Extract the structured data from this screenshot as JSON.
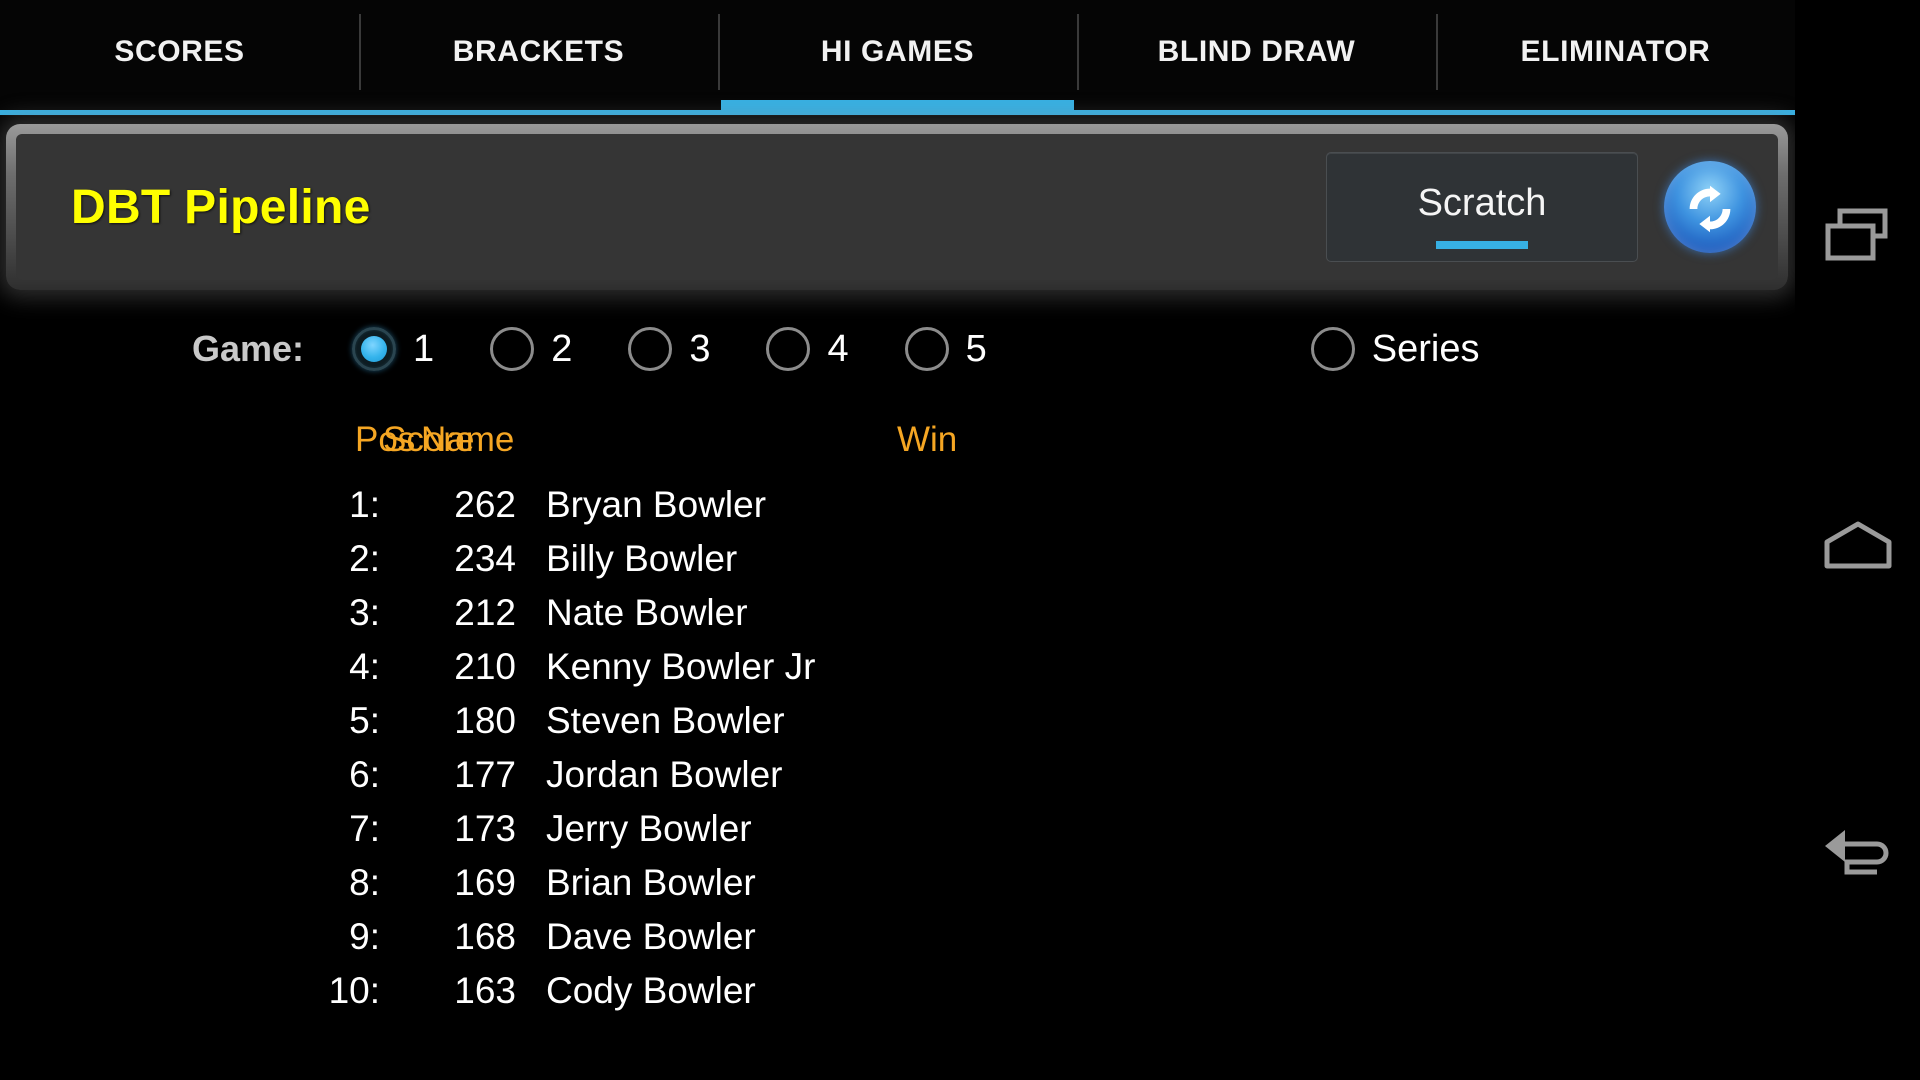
{
  "tabs": {
    "items": [
      {
        "label": "SCORES",
        "active": false
      },
      {
        "label": "BRACKETS",
        "active": false
      },
      {
        "label": "HI GAMES",
        "active": true
      },
      {
        "label": "BLIND DRAW",
        "active": false
      },
      {
        "label": "ELIMINATOR",
        "active": false
      }
    ],
    "active_index": 2,
    "indicator_color": "#37b0e3"
  },
  "header": {
    "title": "DBT Pipeline",
    "title_color": "#ffff00",
    "scratch_label": "Scratch",
    "scratch_underline_color": "#37b0e3",
    "refresh_icon": "refresh-icon"
  },
  "game_selector": {
    "label": "Game:",
    "options": [
      {
        "label": "1",
        "selected": true
      },
      {
        "label": "2",
        "selected": false
      },
      {
        "label": "3",
        "selected": false
      },
      {
        "label": "4",
        "selected": false
      },
      {
        "label": "5",
        "selected": false
      }
    ],
    "series": {
      "label": "Series",
      "selected": false
    },
    "selected_color": "#35b4ec"
  },
  "table": {
    "header_color": "#f5a623",
    "columns": {
      "pos": "Pos",
      "score": "Score",
      "name": "Name",
      "win": "Win"
    },
    "rows": [
      {
        "pos": "1:",
        "score": "262",
        "name": "Bryan Bowler",
        "win": ""
      },
      {
        "pos": "2:",
        "score": "234",
        "name": "Billy Bowler",
        "win": ""
      },
      {
        "pos": "3:",
        "score": "212",
        "name": "Nate Bowler",
        "win": ""
      },
      {
        "pos": "4:",
        "score": "210",
        "name": "Kenny Bowler Jr",
        "win": ""
      },
      {
        "pos": "5:",
        "score": "180",
        "name": "Steven Bowler",
        "win": ""
      },
      {
        "pos": "6:",
        "score": "177",
        "name": "Jordan Bowler",
        "win": ""
      },
      {
        "pos": "7:",
        "score": "173",
        "name": "Jerry Bowler",
        "win": ""
      },
      {
        "pos": "8:",
        "score": "169",
        "name": "Brian Bowler",
        "win": ""
      },
      {
        "pos": "9:",
        "score": "168",
        "name": "Dave Bowler",
        "win": ""
      },
      {
        "pos": "10:",
        "score": "163",
        "name": "Cody Bowler",
        "win": ""
      }
    ]
  },
  "navbar": {
    "recents_icon": "recents-icon",
    "home_icon": "home-icon",
    "back_icon": "back-icon"
  }
}
